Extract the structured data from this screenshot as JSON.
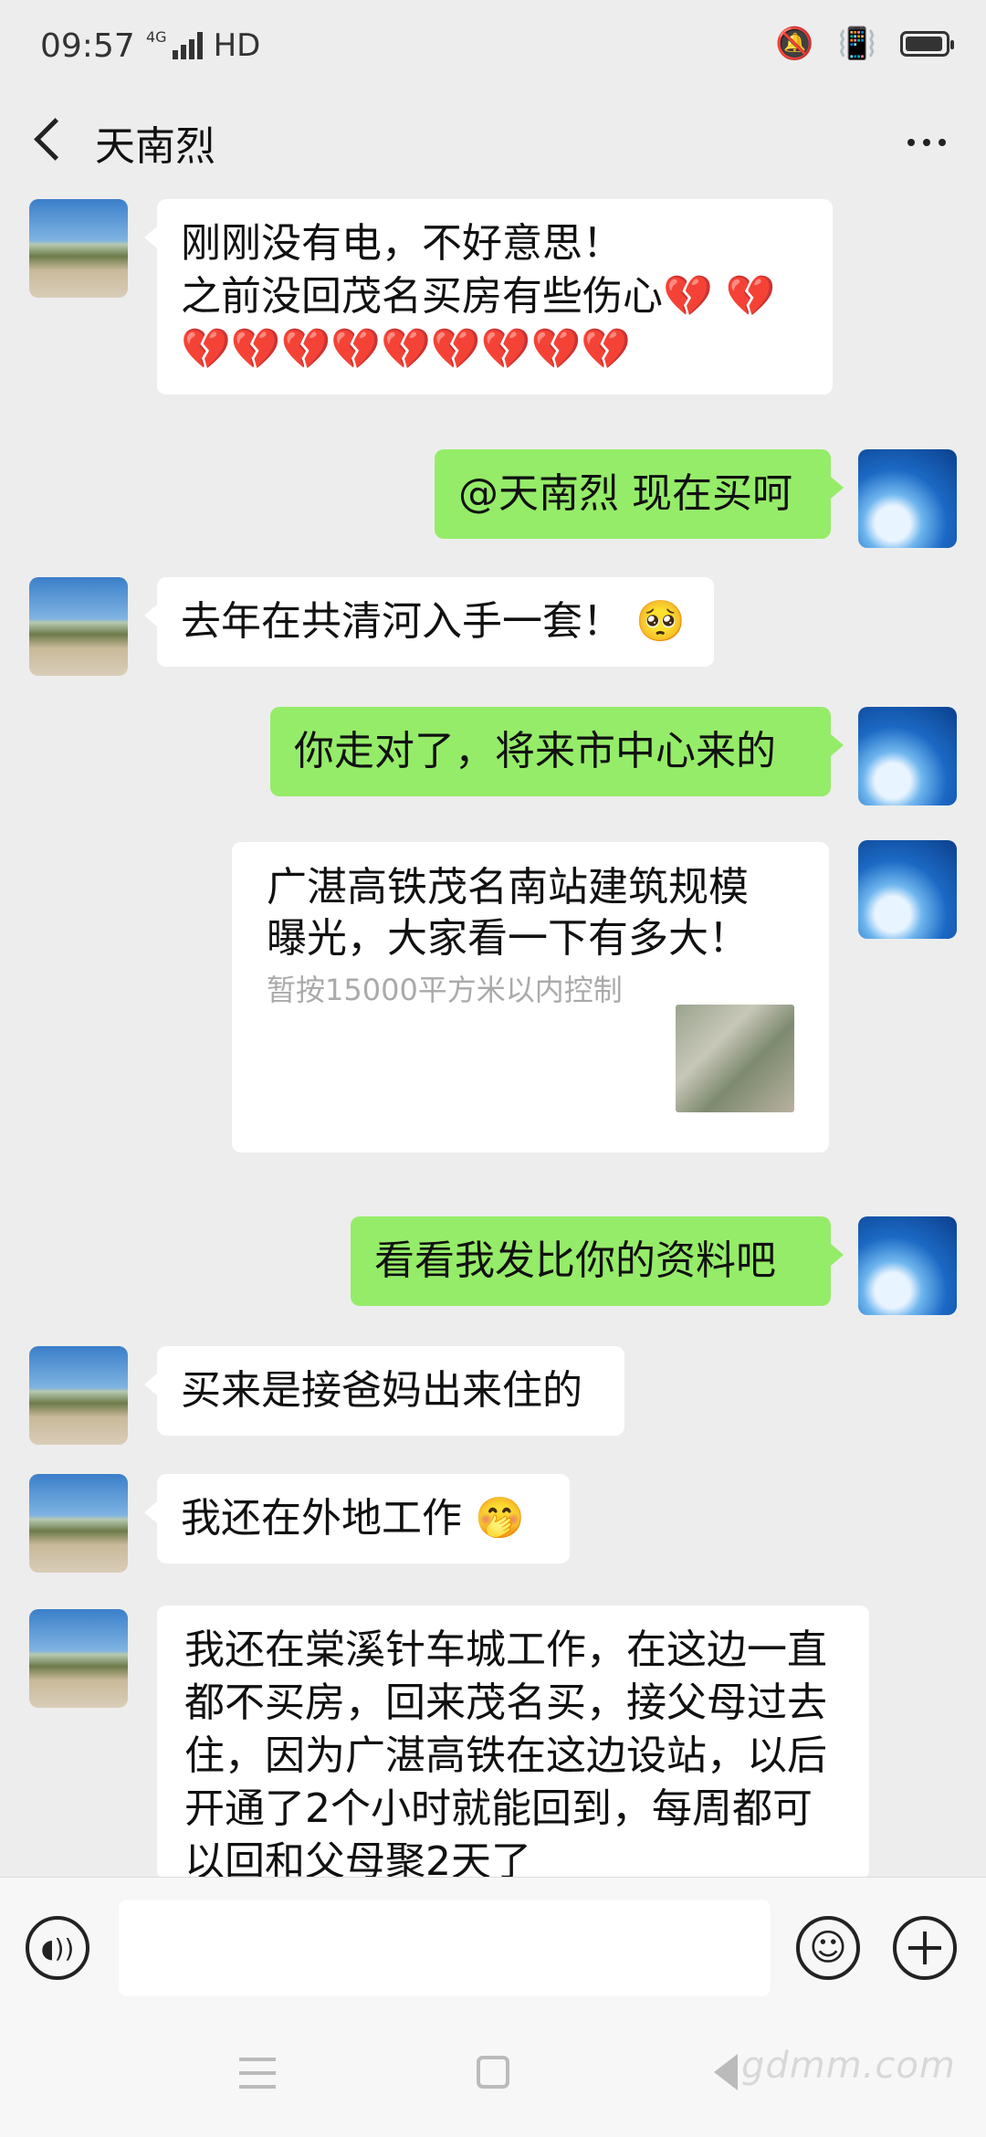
{
  "status_bar": {
    "time": "09:57",
    "network": "4G",
    "hd": "HD",
    "icons": [
      "mute-icon",
      "vibrate-icon",
      "battery-icon"
    ],
    "battery_level": 0.9
  },
  "header": {
    "title": "天南烈",
    "back_icon": "chevron-left-icon",
    "more_icon": "more-dots-icon"
  },
  "messages": [
    {
      "side": "other",
      "text": "刚刚没有电，不好意思！\n之前没回茂名买房有些伤心💔 💔\n💔💔💔💔💔💔💔💔💔"
    },
    {
      "side": "self",
      "text": "@天南烈  现在买呵"
    },
    {
      "side": "other",
      "text": "去年在共清河入手一套！ 🥺"
    },
    {
      "side": "self",
      "text": "你走对了，将来市中心来的"
    },
    {
      "side": "self",
      "type": "link",
      "title": "广湛高铁茂名南站建筑规模曝光，大家看一下有多大！",
      "desc": "暂按15000平方米以内控制"
    },
    {
      "side": "self",
      "text": "看看我发比你的资料吧"
    },
    {
      "side": "other",
      "text": "买来是接爸妈出来住的"
    },
    {
      "side": "other",
      "text": "我还在外地工作  🤭"
    },
    {
      "side": "other",
      "text": "我还在棠溪针车城工作，在这边一直都不买房，回来茂名买，接父母过去住，因为广湛高铁在这边设站，以后开通了2个小时就能回到，每周都可以回和父母聚2天了"
    }
  ],
  "input_bar": {
    "voice_icon": "voice-icon",
    "emoji_icon": "emoji-icon",
    "plus_icon": "plus-icon",
    "placeholder": ""
  },
  "watermark": "gdmm.com",
  "colors": {
    "self_bubble": "#95ec69",
    "other_bubble": "#ffffff",
    "background": "#ededed"
  }
}
